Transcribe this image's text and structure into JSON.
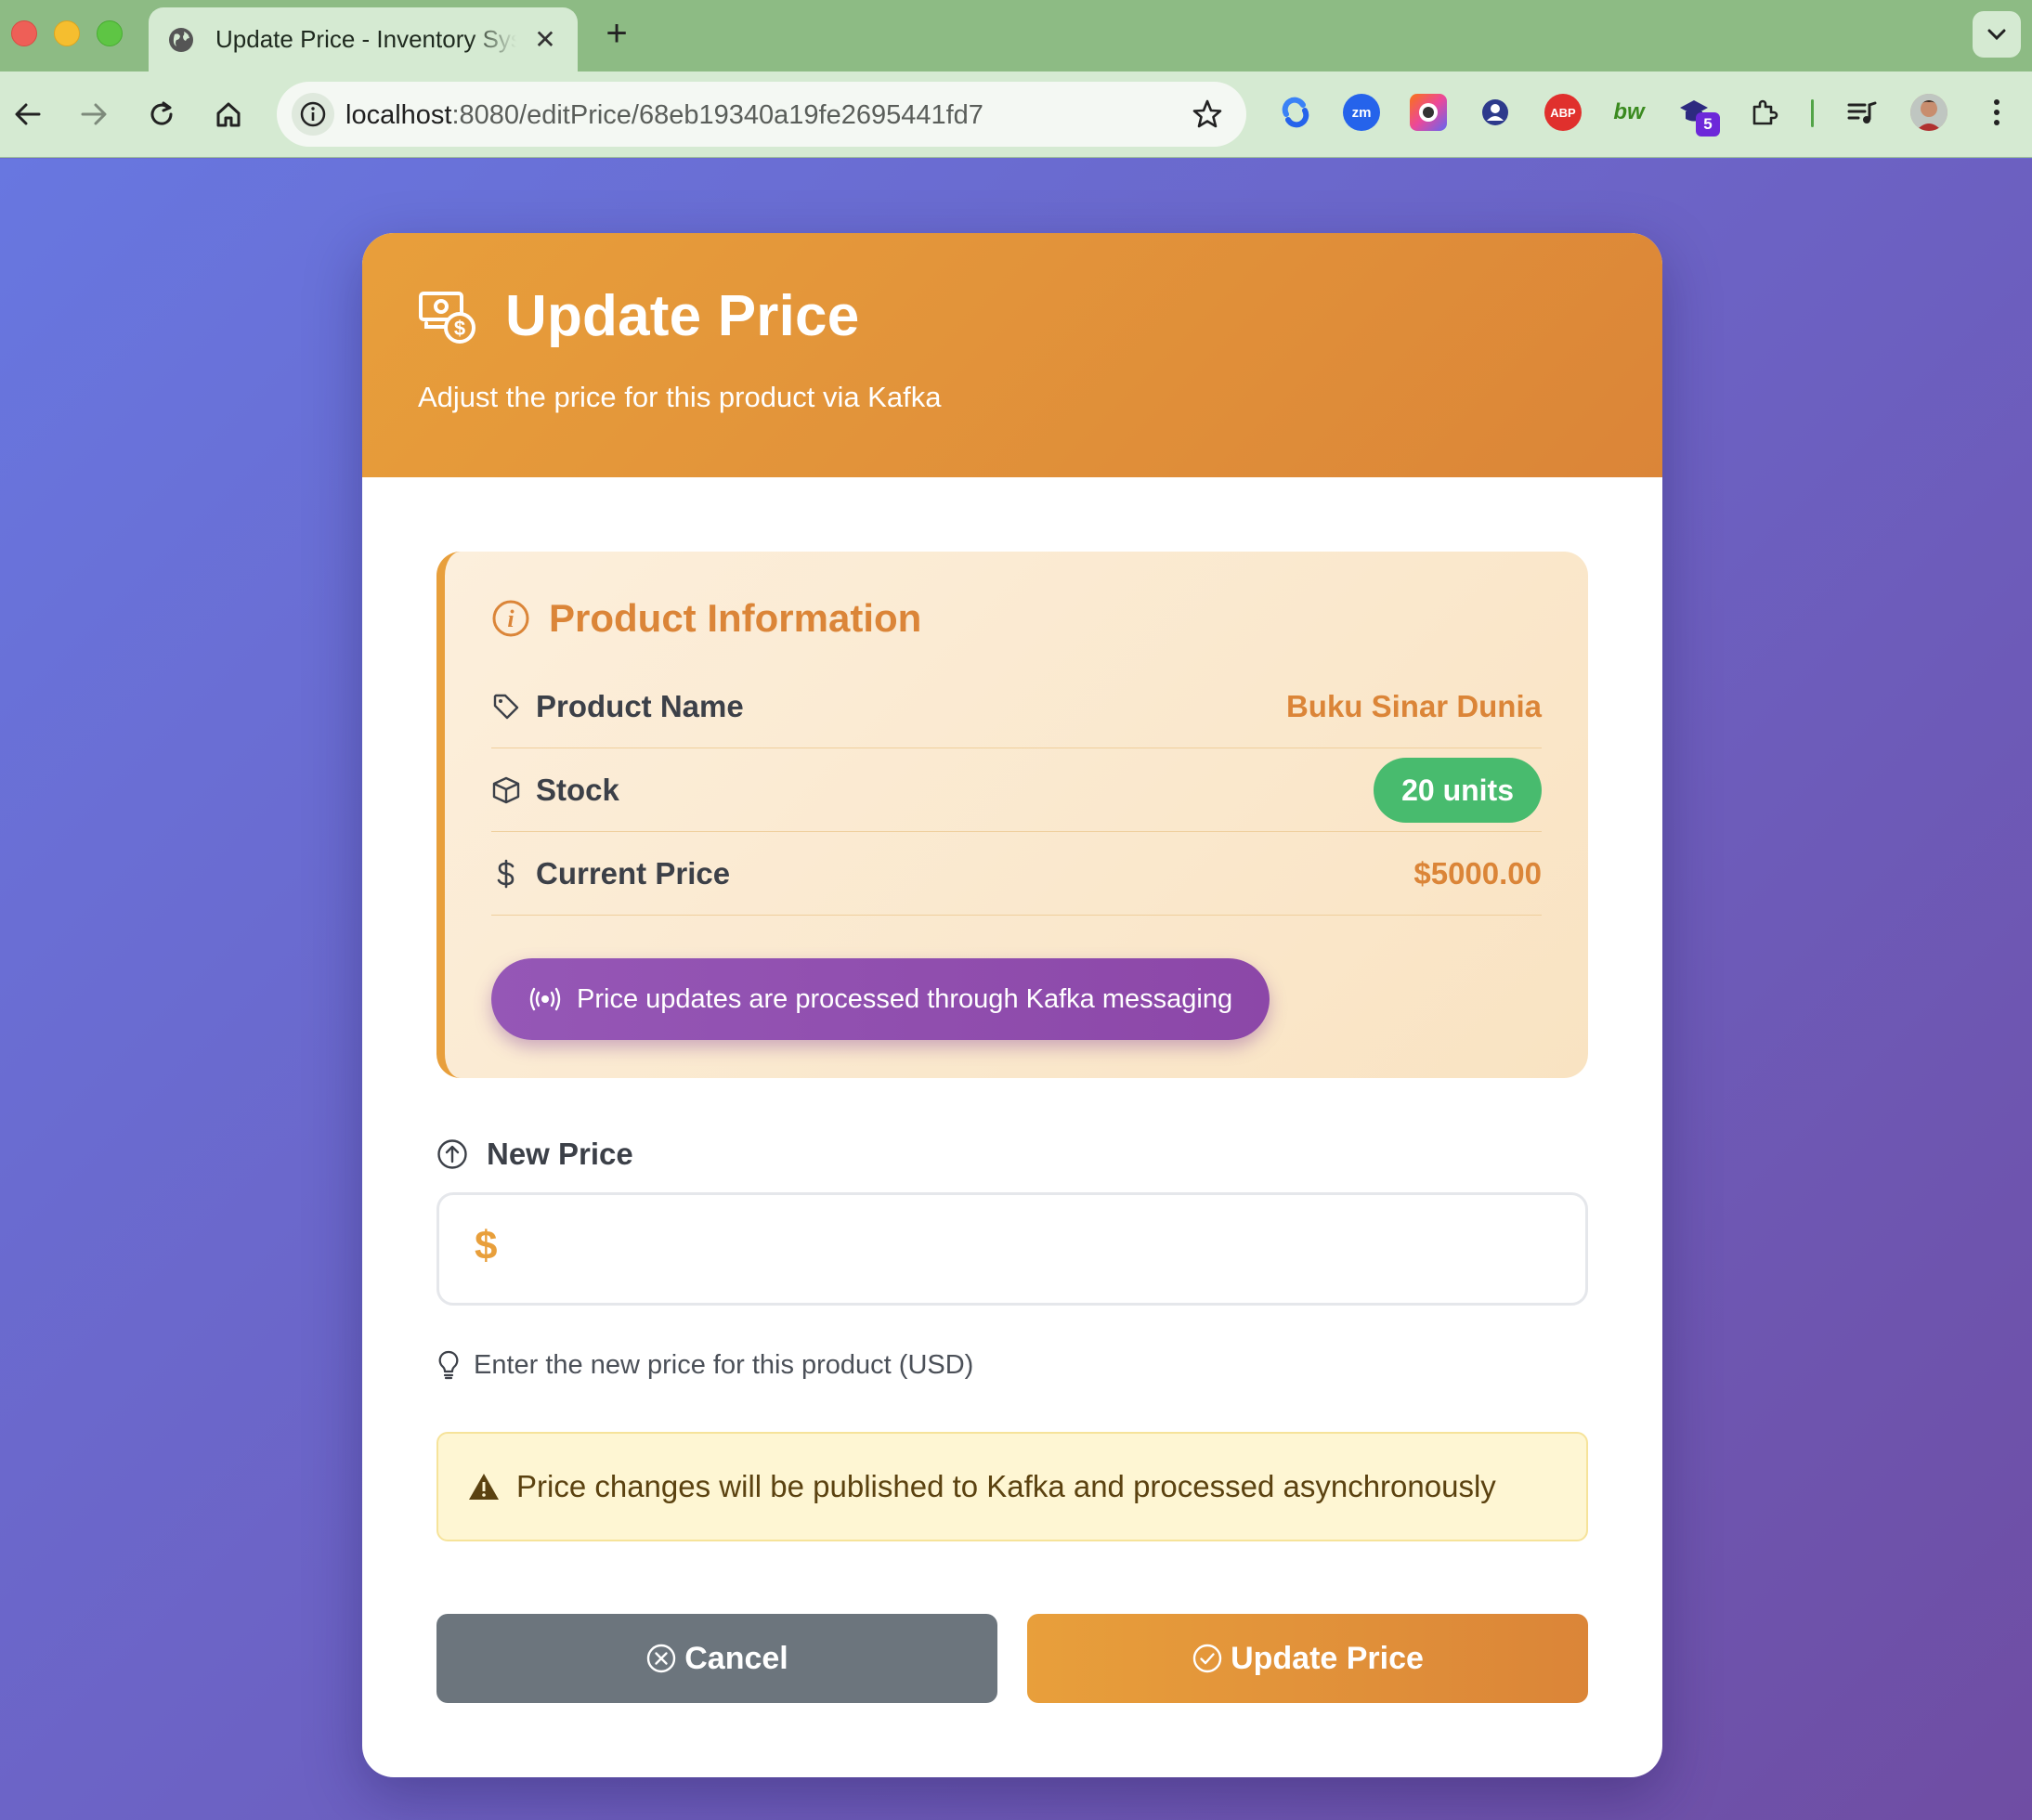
{
  "browser": {
    "tab_title": "Update Price - Inventory System",
    "tab_close": "✕",
    "new_tab": "+",
    "url_host": "localhost",
    "url_path": ":8080/editPrice/68eb19340a19fe2695441fd7",
    "extensions": [
      {
        "name": "sync-extension-icon",
        "label": ""
      },
      {
        "name": "zoom-extension-icon",
        "label": "zm"
      },
      {
        "name": "screen-recorder-extension-icon",
        "label": ""
      },
      {
        "name": "profile-extension-icon",
        "label": ""
      },
      {
        "name": "adblock-extension-icon",
        "label": "ABP"
      },
      {
        "name": "bw-extension-icon",
        "label": "bw"
      },
      {
        "name": "graduation-extension-icon",
        "label": "5"
      }
    ]
  },
  "header": {
    "title": "Update Price",
    "subtitle": "Adjust the price for this product via Kafka"
  },
  "product_info": {
    "title": "Product Information",
    "rows": [
      {
        "label": "Product Name",
        "value": "Buku Sinar Dunia"
      },
      {
        "label": "Stock",
        "value": "20 units"
      },
      {
        "label": "Current Price",
        "value": "$5000.00"
      }
    ],
    "kafka_note": "Price updates are processed through Kafka messaging"
  },
  "form": {
    "new_price_label": "New Price",
    "currency_symbol": "$",
    "input_value": "",
    "hint": "Enter the new price for this product (USD)",
    "warning": "Price changes will be published to Kafka and processed asynchronously"
  },
  "actions": {
    "cancel_label": "Cancel",
    "update_label": "Update Price"
  },
  "colors": {
    "accent": "#e89f3b",
    "accent_dark": "#db8538",
    "stock_badge": "#48bb6e",
    "kafka_pill": "#8c47a8",
    "cancel_button": "#6c757d"
  }
}
